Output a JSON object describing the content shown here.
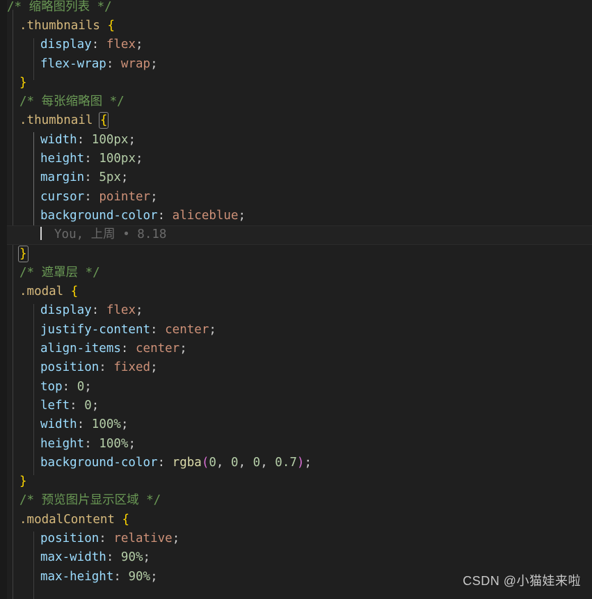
{
  "editor": {
    "language": "css",
    "theme_background": "#1f1f1f",
    "colors": {
      "comment": "#6a9955",
      "selector": "#d7ba7d",
      "brace": "#ffd700",
      "property": "#9cdcfe",
      "value": "#ce9178",
      "number": "#b5cea8",
      "function": "#dcdcaa",
      "paren": "#da70d6",
      "blame": "#6b6b6b",
      "current_line": "#222222",
      "indent_guide": "#404040",
      "indent_guide_active": "#707070"
    }
  },
  "blame": {
    "author": "You,",
    "when": "上周",
    "separator": "•",
    "detail": "8.18",
    "full": "You, 上周 • 8.18"
  },
  "watermark": {
    "text": "CSDN @小猫娃来啦"
  },
  "code": {
    "l01_comment": "/* 缩略图列表 */",
    "l02_selector": ".thumbnails",
    "l02_brace": "{",
    "l03_prop": "display",
    "l03_colon": ":",
    "l03_value": "flex",
    "l03_semi": ";",
    "l04_prop": "flex-wrap",
    "l04_colon": ":",
    "l04_value": "wrap",
    "l04_semi": ";",
    "l05_brace": "}",
    "l06_comment": "/* 每张缩略图 */",
    "l07_selector": ".thumbnail",
    "l07_brace": "{",
    "l08_prop": "width",
    "l08_colon": ":",
    "l08_value": "100px",
    "l08_semi": ";",
    "l09_prop": "height",
    "l09_colon": ":",
    "l09_value": "100px",
    "l09_semi": ";",
    "l10_prop": "margin",
    "l10_colon": ":",
    "l10_value": "5px",
    "l10_semi": ";",
    "l11_prop": "cursor",
    "l11_colon": ":",
    "l11_value": "pointer",
    "l11_semi": ";",
    "l12_prop": "background-color",
    "l12_colon": ":",
    "l12_value": "aliceblue",
    "l12_semi": ";",
    "l14_brace": "}",
    "l15_comment": "/* 遮罩层 */",
    "l16_selector": ".modal",
    "l16_brace": "{",
    "l17_prop": "display",
    "l17_colon": ":",
    "l17_value": "flex",
    "l17_semi": ";",
    "l18_prop": "justify-content",
    "l18_colon": ":",
    "l18_value": "center",
    "l18_semi": ";",
    "l19_prop": "align-items",
    "l19_colon": ":",
    "l19_value": "center",
    "l19_semi": ";",
    "l20_prop": "position",
    "l20_colon": ":",
    "l20_value": "fixed",
    "l20_semi": ";",
    "l21_prop": "top",
    "l21_colon": ":",
    "l21_value": "0",
    "l21_semi": ";",
    "l22_prop": "left",
    "l22_colon": ":",
    "l22_value": "0",
    "l22_semi": ";",
    "l23_prop": "width",
    "l23_colon": ":",
    "l23_value": "100%",
    "l23_semi": ";",
    "l24_prop": "height",
    "l24_colon": ":",
    "l24_value": "100%",
    "l24_semi": ";",
    "l25_prop": "background-color",
    "l25_colon": ":",
    "l25_func": "rgba",
    "l25_lparen": "(",
    "l25_a": "0",
    "l25_c1": ",",
    "l25_b": "0",
    "l25_c2": ",",
    "l25_c": "0",
    "l25_c3": ",",
    "l25_d": "0.7",
    "l25_rparen": ")",
    "l25_semi": ";",
    "l26_brace": "}",
    "l27_comment": "/* 预览图片显示区域 */",
    "l28_selector": ".modalContent",
    "l28_brace": "{",
    "l29_prop": "position",
    "l29_colon": ":",
    "l29_value": "relative",
    "l29_semi": ";",
    "l30_prop": "max-width",
    "l30_colon": ":",
    "l30_value": "90%",
    "l30_semi": ";",
    "l31_prop": "max-height",
    "l31_colon": ":",
    "l31_value": "90%",
    "l31_semi": ";"
  }
}
